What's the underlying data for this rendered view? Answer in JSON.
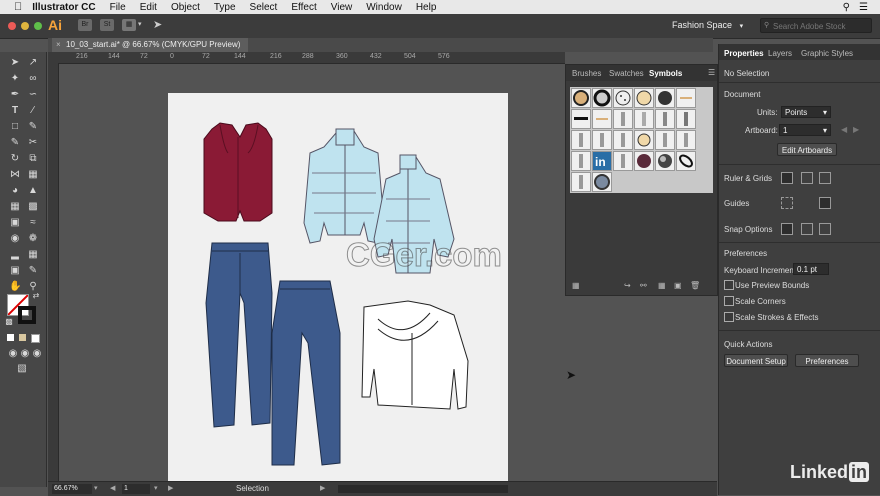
{
  "menubar": {
    "app": "Illustrator CC",
    "items": [
      "File",
      "Edit",
      "Object",
      "Type",
      "Select",
      "Effect",
      "View",
      "Window",
      "Help"
    ]
  },
  "appbar": {
    "logo": "Ai",
    "workspace": "Fashion Space",
    "search_placeholder": "Search Adobe Stock"
  },
  "document": {
    "tab_title": "10_03_start.ai* @ 66.67% (CMYK/GPU Preview)"
  },
  "ruler": {
    "ticks": [
      "216",
      "144",
      "72",
      "0",
      "72",
      "144",
      "216",
      "288",
      "360",
      "432",
      "504",
      "576"
    ]
  },
  "symbols_panel": {
    "tabs": [
      "Brushes",
      "Swatches",
      "Symbols"
    ],
    "active_tab": "Symbols"
  },
  "properties": {
    "tabs": [
      "Properties",
      "Layers",
      "Graphic Styles"
    ],
    "no_selection": "No Selection",
    "document_heading": "Document",
    "units_label": "Units:",
    "units_value": "Points",
    "artboard_label": "Artboard:",
    "artboard_value": "1",
    "edit_artboards": "Edit Artboards",
    "ruler_grids": "Ruler & Grids",
    "guides": "Guides",
    "snap_options": "Snap Options",
    "preferences_heading": "Preferences",
    "keyboard_increment_label": "Keyboard Increment:",
    "keyboard_increment_value": "0.1 pt",
    "use_preview_bounds": "Use Preview Bounds",
    "scale_corners": "Scale Corners",
    "scale_strokes": "Scale Strokes & Effects",
    "quick_actions": "Quick Actions",
    "document_setup": "Document Setup",
    "preferences_button": "Preferences"
  },
  "status": {
    "zoom": "66.67%",
    "artboard": "1",
    "tool": "Selection"
  },
  "watermark": "CGer.com",
  "brand": "Linked",
  "brand_in": "in",
  "colors": {
    "vest": "#8a1a35",
    "jacket": "#bfe3ef",
    "denim": "#3d5a8c",
    "ai_orange": "#f7a43b"
  }
}
